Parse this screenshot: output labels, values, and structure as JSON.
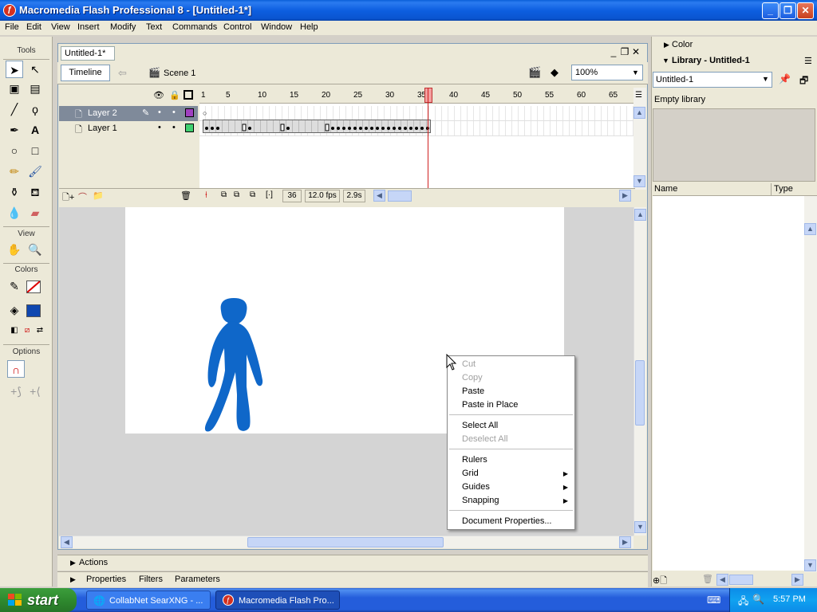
{
  "window": {
    "title": "Macromedia Flash Professional 8 - [Untitled-1*]"
  },
  "menu": [
    "File",
    "Edit",
    "View",
    "Insert",
    "Modify",
    "Text",
    "Commands",
    "Control",
    "Window",
    "Help"
  ],
  "tools": {
    "title": "Tools",
    "view_label": "View",
    "colors_label": "Colors",
    "options_label": "Options"
  },
  "document": {
    "tab": "Untitled-1*",
    "timeline_button": "Timeline",
    "scene": "Scene 1",
    "zoom": "100%"
  },
  "timeline": {
    "layers": [
      "Layer 2",
      "Layer 1"
    ],
    "ticks": [
      "1",
      "5",
      "10",
      "15",
      "20",
      "25",
      "30",
      "35",
      "40",
      "45",
      "50",
      "55",
      "60",
      "65"
    ],
    "current_frame": "36",
    "fps": "12.0 fps",
    "time": "2.9s"
  },
  "context_menu": {
    "items": [
      {
        "label": "Cut",
        "disabled": true
      },
      {
        "label": "Copy",
        "disabled": true
      },
      {
        "label": "Paste",
        "disabled": false
      },
      {
        "label": "Paste in Place",
        "disabled": false
      },
      {
        "label": "Select All",
        "disabled": false
      },
      {
        "label": "Deselect All",
        "disabled": true
      },
      {
        "label": "Rulers",
        "disabled": false
      },
      {
        "label": "Grid",
        "disabled": false,
        "submenu": true
      },
      {
        "label": "Guides",
        "disabled": false,
        "submenu": true
      },
      {
        "label": "Snapping",
        "disabled": false,
        "submenu": true
      },
      {
        "label": "Document Properties...",
        "disabled": false
      }
    ]
  },
  "bottom_panels": {
    "actions": "Actions",
    "properties": "Properties",
    "filters": "Filters",
    "parameters": "Parameters"
  },
  "right_panel": {
    "color": "Color",
    "library": "Library - Untitled-1",
    "library_select": "Untitled-1",
    "empty": "Empty library",
    "col_name": "Name",
    "col_type": "Type"
  },
  "taskbar": {
    "start": "start",
    "items": [
      "CollabNet SearXNG - ...",
      "Macromedia Flash Pro..."
    ],
    "clock": "5:57 PM"
  },
  "colors": {
    "figure": "#0f67c9",
    "titlebar": "#0a54d0"
  }
}
